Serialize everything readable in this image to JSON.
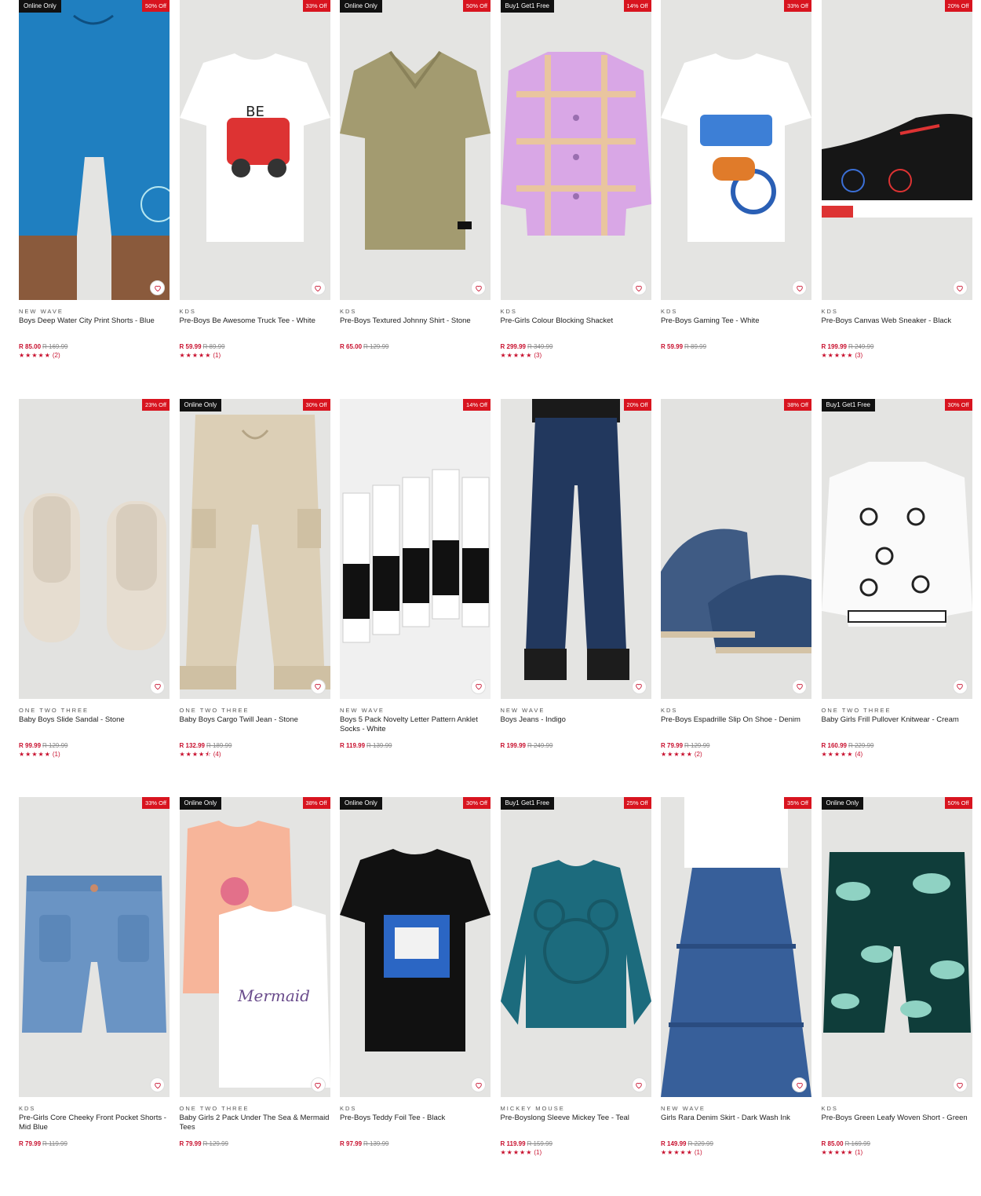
{
  "products": [
    {
      "tag": "Online Only",
      "discount": "50% Off",
      "brand": "NEW WAVE",
      "name": "Boys Deep Water City Print Shorts - Blue",
      "price": "R 85.00",
      "was": "R 169.99",
      "stars": "★★★★★",
      "reviews": "(2)",
      "art": "shorts-blue"
    },
    {
      "tag": "",
      "discount": "33% Off",
      "brand": "KDS",
      "name": "Pre-Boys Be Awesome Truck Tee - White",
      "price": "R 59.99",
      "was": "R 89.99",
      "stars": "★★★★★",
      "reviews": "(1)",
      "art": "tee-white-truck"
    },
    {
      "tag": "Online Only",
      "discount": "50% Off",
      "brand": "KDS",
      "name": "Pre-Boys Textured Johnny Shirt - Stone",
      "price": "R 65.00",
      "was": "R 129.99",
      "stars": "",
      "reviews": "",
      "art": "polo-olive"
    },
    {
      "tag": "Buy1 Get1 Free",
      "discount": "14% Off",
      "brand": "KDS",
      "name": "Pre-Girls Colour Blocking Shacket",
      "price": "R 299.99",
      "was": "R 349.99",
      "stars": "★★★★★",
      "reviews": "(3)",
      "art": "shacket"
    },
    {
      "tag": "",
      "discount": "33% Off",
      "brand": "KDS",
      "name": "Pre-Boys Gaming Tee - White",
      "price": "R 59.99",
      "was": "R 89.99",
      "stars": "",
      "reviews": "",
      "art": "tee-white-gamer"
    },
    {
      "tag": "",
      "discount": "20% Off",
      "brand": "KDS",
      "name": "Pre-Boys Canvas Web Sneaker - Black",
      "price": "R 199.99",
      "was": "R 249.99",
      "stars": "★★★★★",
      "reviews": "(3)",
      "art": "sneaker"
    },
    {
      "tag": "",
      "discount": "23% Off",
      "brand": "ONE TWO THREE",
      "name": "Baby Boys Slide Sandal - Stone",
      "price": "R 99.99",
      "was": "R 129.99",
      "stars": "★★★★★",
      "reviews": "(1)",
      "art": "slides"
    },
    {
      "tag": "Online Only",
      "discount": "30% Off",
      "brand": "ONE TWO THREE",
      "name": "Baby Boys Cargo Twill Jean - Stone",
      "price": "R 132.99",
      "was": "R 189.99",
      "stars": "★★★★⯪",
      "reviews": "(4)",
      "art": "cargo"
    },
    {
      "tag": "",
      "discount": "14% Off",
      "brand": "NEW WAVE",
      "name": "Boys 5 Pack Novelty Letter Pattern Anklet Socks - White",
      "price": "R 119.99",
      "was": "R 139.99",
      "stars": "",
      "reviews": "",
      "art": "socks"
    },
    {
      "tag": "",
      "discount": "20% Off",
      "brand": "NEW WAVE",
      "name": "Boys Jeans - Indigo",
      "price": "R 199.99",
      "was": "R 249.99",
      "stars": "",
      "reviews": "",
      "art": "jeans"
    },
    {
      "tag": "",
      "discount": "38% Off",
      "brand": "KDS",
      "name": "Pre-Boys Espadrille Slip On Shoe - Denim",
      "price": "R 79.99",
      "was": "R 129.99",
      "stars": "★★★★★",
      "reviews": "(2)",
      "art": "espadrille"
    },
    {
      "tag": "Buy1 Get1 Free",
      "discount": "30% Off",
      "brand": "ONE TWO THREE",
      "name": "Baby Girls Frill Pullover Knitwear - Cream",
      "price": "R 160.99",
      "was": "R 229.99",
      "stars": "★★★★★",
      "reviews": "(4)",
      "art": "knit"
    },
    {
      "tag": "",
      "discount": "33% Off",
      "brand": "KDS",
      "name": "Pre-Girls Core Cheeky Front Pocket Shorts - Mid Blue",
      "price": "R 79.99",
      "was": "R 119.99",
      "stars": "",
      "reviews": "",
      "art": "denim-shorts"
    },
    {
      "tag": "Online Only",
      "discount": "38% Off",
      "brand": "ONE TWO THREE",
      "name": "Baby Girls 2 Pack Under The Sea & Mermaid Tees",
      "price": "R 79.99",
      "was": "R 129.99",
      "stars": "",
      "reviews": "",
      "art": "mermaid"
    },
    {
      "tag": "Online Only",
      "discount": "30% Off",
      "brand": "KDS",
      "name": "Pre-Boys Teddy Foil Tee - Black",
      "price": "R 97.99",
      "was": "R 139.99",
      "stars": "",
      "reviews": "",
      "art": "tee-black"
    },
    {
      "tag": "Buy1 Get1 Free",
      "discount": "25% Off",
      "brand": "MICKEY MOUSE",
      "name": "Pre-Boyslong Sleeve Mickey Tee - Teal",
      "price": "R 119.99",
      "was": "R 159.99",
      "stars": "★★★★★",
      "reviews": "(1)",
      "art": "teal-ls"
    },
    {
      "tag": "",
      "discount": "35% Off",
      "brand": "NEW WAVE",
      "name": "Girls Rara Denim Skirt - Dark Wash Ink",
      "price": "R 149.99",
      "was": "R 229.99",
      "stars": "★★★★★",
      "reviews": "(1)",
      "art": "skirt"
    },
    {
      "tag": "Online Only",
      "discount": "50% Off",
      "brand": "KDS",
      "name": "Pre-Boys Green Leafy Woven Short - Green",
      "price": "R 85.00",
      "was": "R 169.99",
      "stars": "★★★★★",
      "reviews": "(1)",
      "art": "leafy"
    }
  ]
}
